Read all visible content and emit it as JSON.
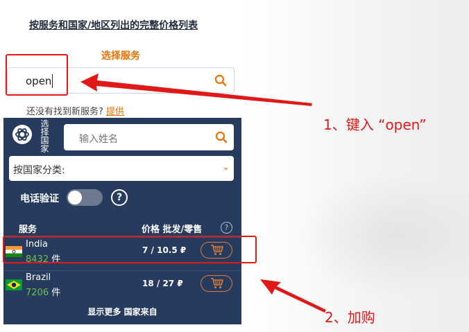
{
  "header": {
    "full_price_link": "按服务和国家/地区列出的完整价格列表",
    "choose_service": "选择服务"
  },
  "service_search": {
    "value": "open",
    "icon": "search-icon"
  },
  "hint": {
    "text": "还没有找到新服务?",
    "link": "提供"
  },
  "panel": {
    "country_label": "选择国家",
    "name_search_placeholder": "输入姓名",
    "country_select": "按国家分类:",
    "phone_verify_label": "电话验证",
    "help": "?",
    "columns": {
      "service": "服务",
      "price": "价格 批发/零售",
      "help": "?"
    },
    "rows": [
      {
        "country": "India",
        "count": "8432",
        "unit": "件",
        "price": "7 / 10.5 ₽",
        "flag": "india-flag-icon"
      },
      {
        "country": "Brazil",
        "count": "7206",
        "unit": "件",
        "price": "18 / 27 ₽",
        "flag": "brazil-flag-icon"
      }
    ],
    "show_more": "显示更多 国家来自"
  },
  "annotations": {
    "step1": "1、键入 “open”",
    "step2": "2、加购"
  },
  "colors": {
    "accent": "#f07000",
    "panel_bg": "#263b5d",
    "annotation_red": "#e01818",
    "count_green": "#6fc24a"
  }
}
